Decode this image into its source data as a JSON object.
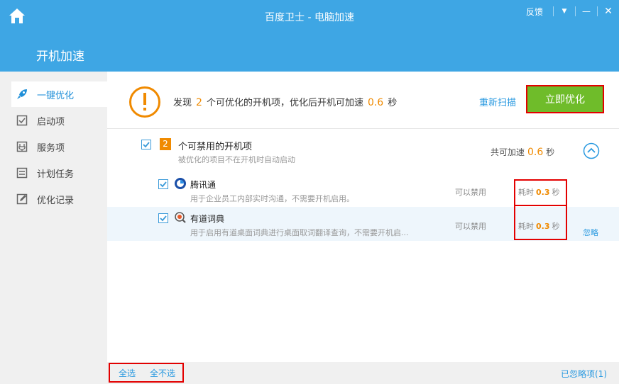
{
  "window": {
    "title": "百度卫士 - 电脑加速",
    "feedback_label": "反馈",
    "menu_glyph": "▼",
    "minimize_glyph": "—",
    "close_glyph": "✕"
  },
  "header": {
    "page_heading": "开机加速"
  },
  "sidebar": {
    "items": [
      {
        "label": "一键优化",
        "icon": "rocket-icon",
        "active": true
      },
      {
        "label": "启动项",
        "icon": "checkbox-icon",
        "active": false
      },
      {
        "label": "服务项",
        "icon": "service-icon",
        "active": false
      },
      {
        "label": "计划任务",
        "icon": "schedule-icon",
        "active": false
      },
      {
        "label": "优化记录",
        "icon": "record-icon",
        "active": false
      }
    ]
  },
  "summary": {
    "prefix": "发现",
    "count": "2",
    "middle": "个可优化的开机项，优化后开机可加速",
    "speedup": "0.6",
    "unit": "秒",
    "rescan_label": "重新扫描",
    "optimize_label": "立即优化"
  },
  "group": {
    "count": "2",
    "title": "个可禁用的开机项",
    "subtitle": "被优化的项目不在开机时自动启动",
    "total_prefix": "共可加速",
    "total_value": "0.6",
    "total_unit": "秒"
  },
  "items": [
    {
      "name": "腾讯通",
      "description": "用于企业员工内部实时沟通，不需要开机启用。",
      "status": "可以禁用",
      "cost_prefix": "耗时",
      "cost_value": "0.3",
      "cost_unit": "秒",
      "ignore_label": ""
    },
    {
      "name": "有道词典",
      "description": "用于启用有道桌面词典进行桌面取词翻译查询，不需要开机启...",
      "status": "可以禁用",
      "cost_prefix": "耗时",
      "cost_value": "0.3",
      "cost_unit": "秒",
      "ignore_label": "忽略"
    }
  ],
  "footer": {
    "select_all": "全选",
    "select_none": "全不选",
    "ignored_items": "已忽略项(1)"
  },
  "colors": {
    "header_blue": "#3ea6e4",
    "accent_orange": "#f08a00",
    "link_blue": "#2b9ae0",
    "optimize_green": "#6fbc2a",
    "highlight_red": "#e30000"
  }
}
